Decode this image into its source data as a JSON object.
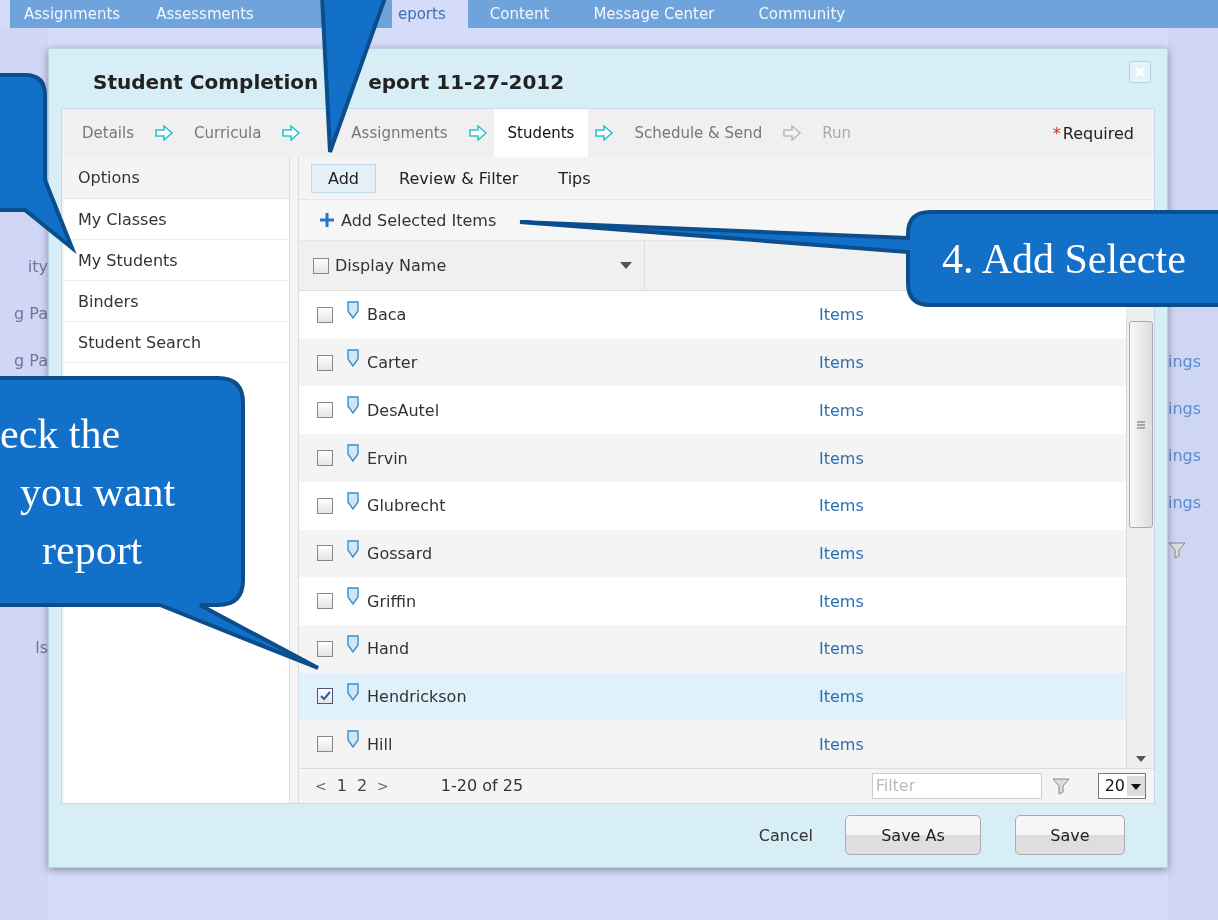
{
  "background": {
    "nav": [
      {
        "label": "Assignments",
        "selected": false
      },
      {
        "label": "Assessments",
        "selected": false
      },
      {
        "label": "eports",
        "selected": true
      },
      {
        "label": "Content",
        "selected": false
      },
      {
        "label": "Message Center",
        "selected": false
      },
      {
        "label": "Community",
        "selected": false
      }
    ],
    "left_fragments": [
      "ity",
      "g Pa",
      "g Pa",
      "ls"
    ],
    "right_fragments": [
      "ings",
      "ings",
      "ings",
      "ings"
    ]
  },
  "dialog": {
    "title": [
      "Student Completion",
      "eport 11-27-2012"
    ],
    "steps": [
      {
        "label": "Details",
        "selected": false,
        "reachable": true
      },
      {
        "label": "Curricula",
        "selected": false,
        "reachable": true
      },
      {
        "label": "Assignments",
        "selected": false,
        "reachable": true
      },
      {
        "label": "Students",
        "selected": true,
        "reachable": true
      },
      {
        "label": "Schedule & Send",
        "selected": false,
        "reachable": true
      },
      {
        "label": "Run",
        "selected": false,
        "reachable": false
      }
    ],
    "required": {
      "mark": "*",
      "label": "Required"
    },
    "options": {
      "title": "Options",
      "items": [
        "My Classes",
        "My Students",
        "Binders",
        "Student Search"
      ]
    },
    "subtabs": [
      {
        "label": "Add",
        "selected": true
      },
      {
        "label": "Review & Filter",
        "selected": false
      },
      {
        "label": "Tips",
        "selected": false
      }
    ],
    "add_selected": "Add Selected Items",
    "column": "Display Name",
    "select_all": {
      "checked": false
    },
    "rows": [
      {
        "name": "Baca",
        "link": "Items",
        "checked": false,
        "selected": false
      },
      {
        "name": "Carter",
        "link": "Items",
        "checked": false,
        "selected": false
      },
      {
        "name": "DesAutel",
        "link": "Items",
        "checked": false,
        "selected": false
      },
      {
        "name": "Ervin",
        "link": "Items",
        "checked": false,
        "selected": false
      },
      {
        "name": "Glubrecht",
        "link": "Items",
        "checked": false,
        "selected": false
      },
      {
        "name": "Gossard",
        "link": "Items",
        "checked": false,
        "selected": false
      },
      {
        "name": "Griffin",
        "link": "Items",
        "checked": false,
        "selected": false
      },
      {
        "name": "Hand",
        "link": "Items",
        "checked": false,
        "selected": false
      },
      {
        "name": "Hendrickson",
        "link": "Items",
        "checked": true,
        "selected": true
      },
      {
        "name": "Hill",
        "link": "Items",
        "checked": false,
        "selected": false
      }
    ],
    "pager": {
      "prev": "<",
      "pages": [
        "1",
        "2"
      ],
      "next": ">",
      "range": "1-20 of 25",
      "filter_placeholder": "Filter",
      "page_size": "20"
    },
    "buttons": {
      "cancel": "Cancel",
      "save_as": "Save As",
      "save": "Save"
    }
  },
  "callouts": [
    {
      "kind": "left"
    },
    {
      "kind": "top"
    },
    {
      "kind": "right",
      "lines": [
        "4. Add Selecte"
      ]
    },
    {
      "kind": "lower",
      "lines": [
        "eck the",
        "you want",
        "report"
      ]
    }
  ]
}
